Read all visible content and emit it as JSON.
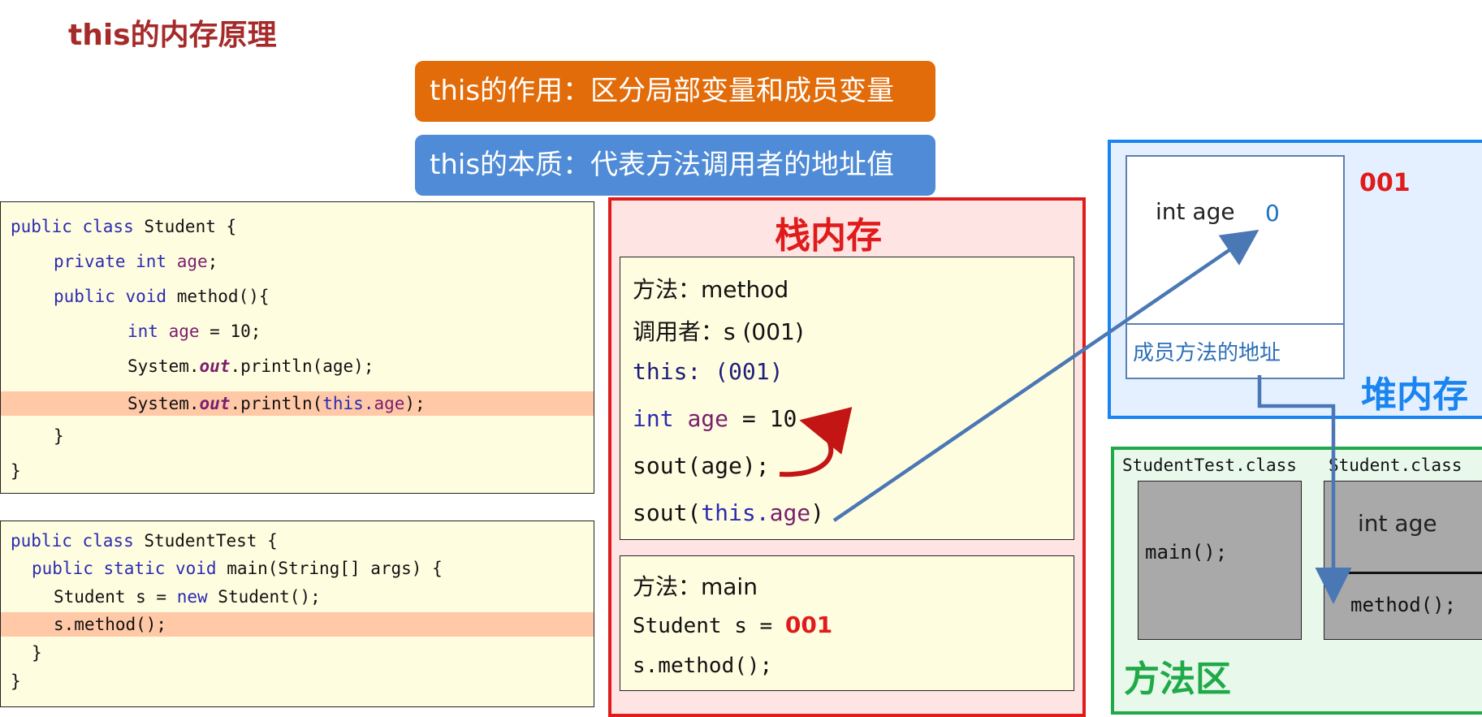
{
  "title": "this的内存原理",
  "banners": {
    "purpose": "this的作用：区分局部变量和成员变量",
    "essence": "this的本质：代表方法调用者的地址值"
  },
  "student_class_code": {
    "l1_kw1": "public class",
    "l1_rest": " Student {",
    "l2_kw": "private int",
    "l2_field": "age",
    "l2_end": ";",
    "l3_kw": "public void",
    "l3_rest": " method(){",
    "l4_kw": "int",
    "l4_var": "age",
    "l4_rest": " = 10;",
    "l5_a": "System.",
    "l5_out": "out",
    "l5_b": ".println(age);",
    "l6_a": "System.",
    "l6_out": "out",
    "l6_b": ".println(",
    "l6_this": "this.",
    "l6_field": "age",
    "l6_c": ");",
    "l7": "}",
    "l8": "}"
  },
  "student_test_code": {
    "l1_kw": "public class",
    "l1_rest": " StudentTest {",
    "l2_kw": "public static void",
    "l2_rest": " main(String[] args) {",
    "l3_a": "Student s = ",
    "l3_kw": "new",
    "l3_b": " Student();",
    "l4": "s.method();",
    "l5": "}",
    "l6": "}"
  },
  "stack": {
    "title": "栈内存",
    "method_frame": {
      "name": "方法：method",
      "caller": "调用者：s (001)",
      "this_label": "this: ",
      "this_value": "(001)",
      "local_kw": "int",
      "local_var": "age",
      "local_rest": " = 10",
      "sout1": "sout(age);",
      "sout2_a": "sout(",
      "sout2_this": "this.",
      "sout2_field": "age",
      "sout2_b": ")"
    },
    "main_frame": {
      "name": "方法：main",
      "decl": "Student s = ",
      "addr": "001",
      "call": "s.method();"
    }
  },
  "heap": {
    "title": "堆内存",
    "address": "001",
    "field_label": "int age",
    "field_value": "0",
    "methods_label": "成员方法的地址"
  },
  "method_area": {
    "title": "方法区",
    "class1": {
      "name": "StudentTest.class",
      "content": "main();"
    },
    "class2": {
      "name": "Student.class",
      "field": "int age",
      "method": "method();"
    }
  },
  "colors": {
    "title": "#a52a2a",
    "banner_orange": "#e36c0a",
    "banner_blue": "#4f8bd6",
    "stack_red": "#e01b1b",
    "heap_blue": "#1a84f0",
    "method_green": "#1faa48",
    "arrow": "#4a78b4",
    "highlight": "#ffc8a6",
    "panel": "#fffde0"
  }
}
